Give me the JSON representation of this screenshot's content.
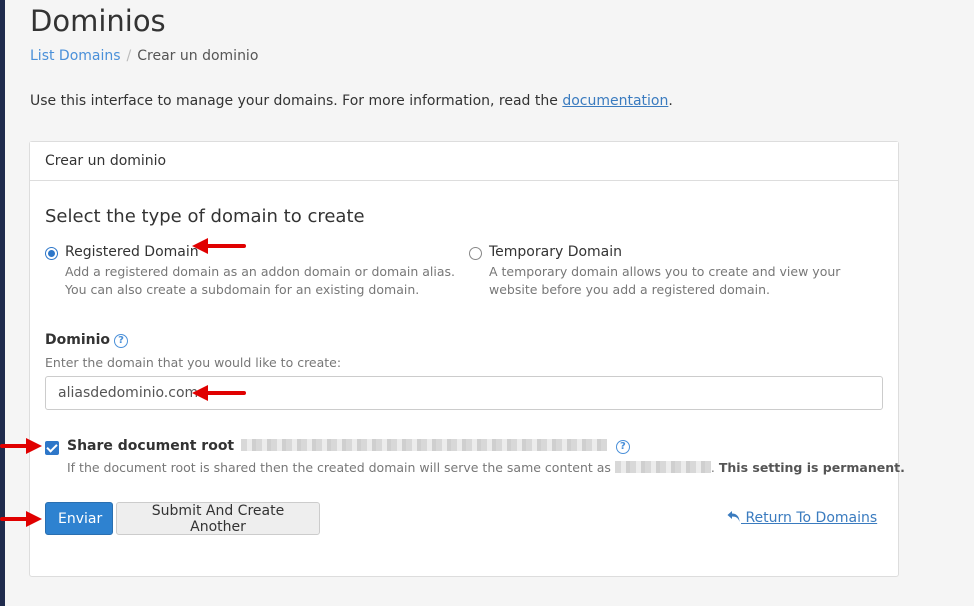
{
  "page": {
    "title": "Dominios",
    "breadcrumb": {
      "link": "List Domains",
      "separator": "/",
      "current": "Crear un dominio"
    },
    "intro_text": "Use this interface to manage your domains. For more information, read the ",
    "intro_link": "documentation",
    "intro_end": "."
  },
  "panel": {
    "heading": "Crear un dominio",
    "section_title": "Select the type of domain to create",
    "options": [
      {
        "label": "Registered Domain",
        "help_line1": "Add a registered domain as an addon domain or domain alias.",
        "help_line2": "You can also create a subdomain for an existing domain.",
        "selected": true
      },
      {
        "label": "Temporary Domain",
        "help_line1": "A temporary domain allows you to create and view your",
        "help_line2": "website before you add a registered domain.",
        "selected": false
      }
    ],
    "domain_label": "Dominio",
    "domain_hint": "Enter the domain that you would like to create:",
    "domain_value": "aliasdedominio.com",
    "share_label": "Share document root",
    "share_checked": true,
    "share_help": "If the document root is shared then the created domain will serve the same content as",
    "share_help_bold": "This setting is permanent.",
    "submit_label": "Enviar",
    "submit_another_label": "Submit And Create Another",
    "return_label": "Return To Domains"
  },
  "colors": {
    "accent": "#2e82d0",
    "link": "#3a7bbf",
    "annotation_arrow": "#e00000"
  }
}
